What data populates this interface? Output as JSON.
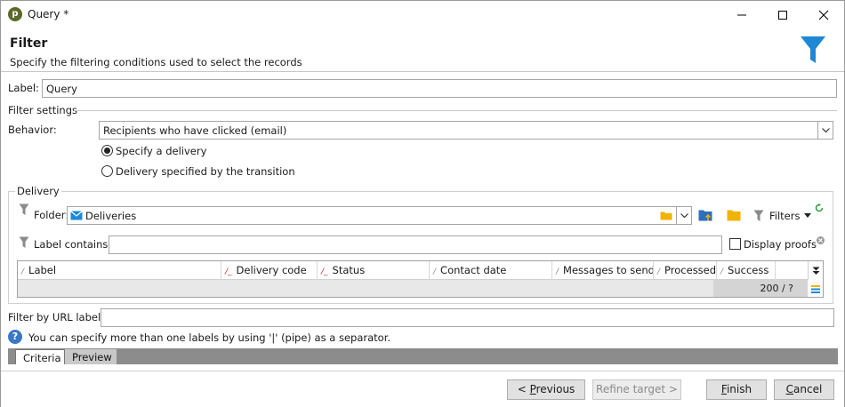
{
  "window": {
    "title": "Query *"
  },
  "header": {
    "title": "Filter",
    "subtitle": "Specify the filtering conditions used to select the records"
  },
  "label_field": {
    "label": "Label:",
    "value": "Query"
  },
  "filter_settings": {
    "title": "Filter settings",
    "behavior_label": "Behavior:",
    "behavior_value": "Recipients who have clicked (email)",
    "radio_specify": "Specify a delivery",
    "radio_transition": "Delivery specified by the transition"
  },
  "delivery": {
    "title": "Delivery",
    "folder_label": "Folder:",
    "folder_value": "Deliveries",
    "filters_label": "Filters",
    "label_contains": "Label contains:",
    "display_proofs": "Display proofs",
    "columns": [
      "Label",
      "Delivery code",
      "Status",
      "Contact date",
      "Messages to send",
      "Processed",
      "Success"
    ],
    "count": "200 / ?"
  },
  "url_filter": {
    "label": "Filter by URL label:",
    "value": ""
  },
  "info_text": "You can specify more than one labels by using '|' (pipe) as a separator.",
  "tabs": [
    "Criteria",
    "Preview"
  ],
  "buttons": {
    "previous_mn": "P",
    "previous_pre": "< ",
    "previous_rest": "revious",
    "refine": "Refine target >",
    "finish_mn": "F",
    "finish_rest": "inish",
    "cancel_mn": "C",
    "cancel_rest": "ancel"
  },
  "colors": {
    "accent_blue": "#1e88d6",
    "folder_yellow": "#f0b400",
    "tab_strip": "#8c8c8c"
  }
}
